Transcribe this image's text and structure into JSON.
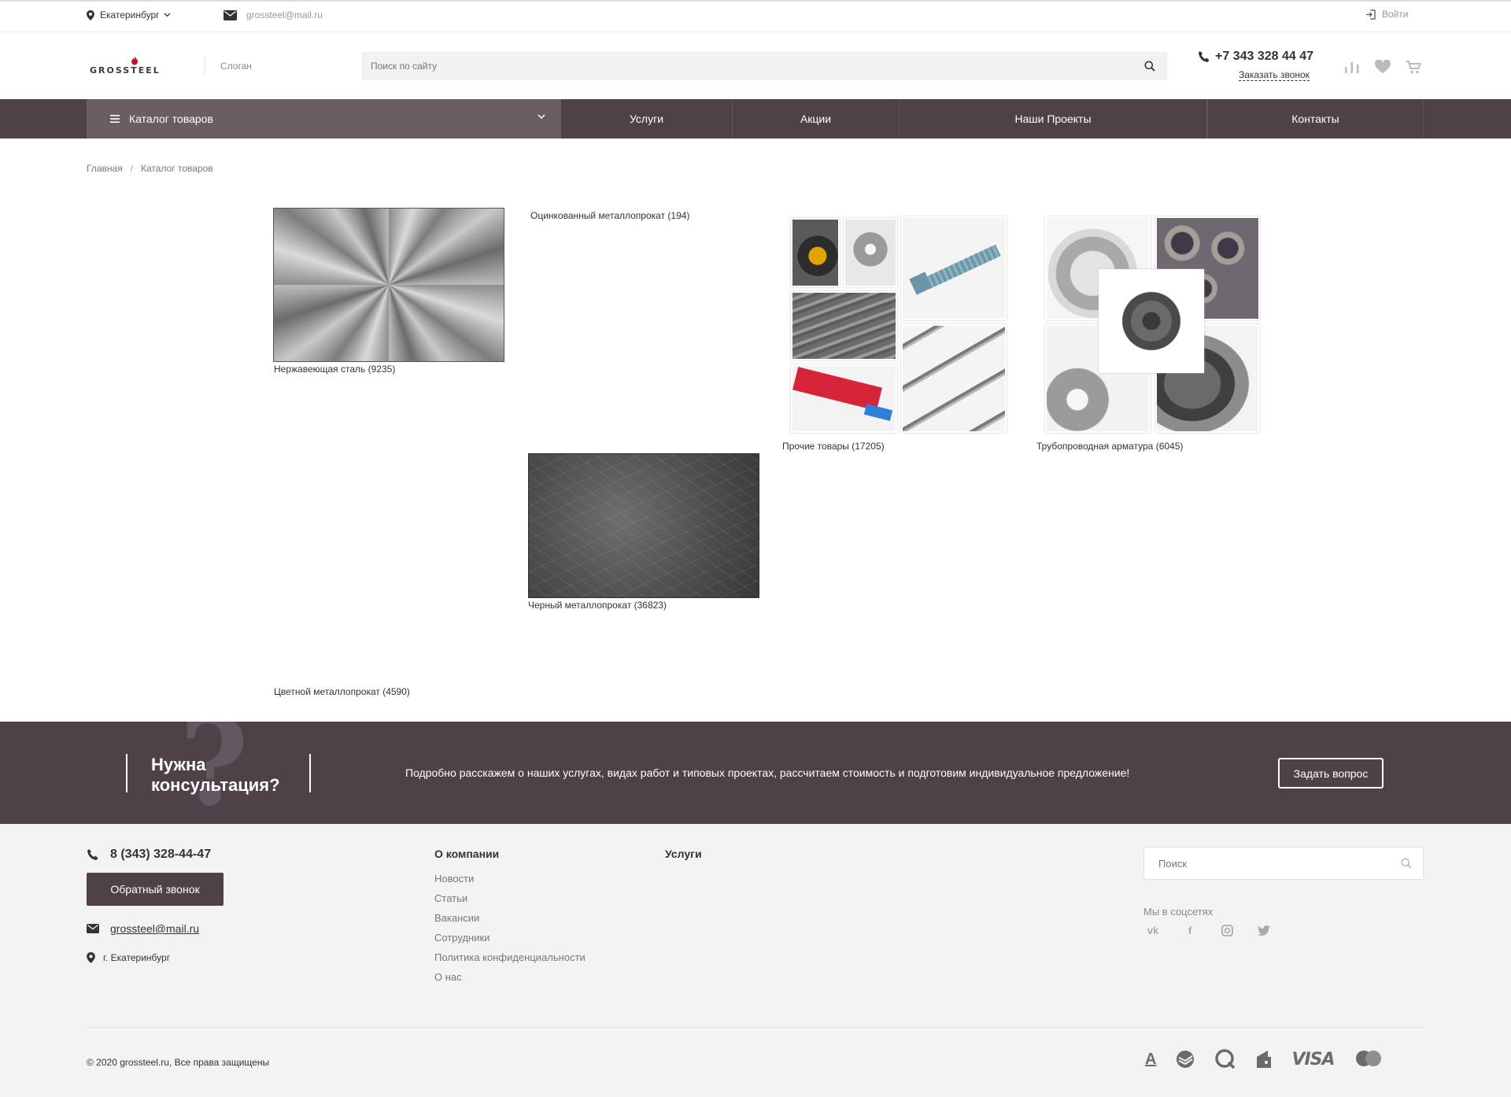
{
  "topbar": {
    "city": "Екатеринбург",
    "email": "grossteel@mail.ru",
    "login": "Войти"
  },
  "header": {
    "logo_text": "GROSSTEEL",
    "slogan": "Слоган",
    "search_placeholder": "Поиск по сайту",
    "phone": "+7 343 328 44 47",
    "callback": "Заказать звонок"
  },
  "nav": {
    "catalog": "Каталог товаров",
    "items": [
      "Услуги",
      "Акции",
      "Наши Проекты",
      "Контакты"
    ]
  },
  "breadcrumb": {
    "home": "Главная",
    "current": "Каталог товаров"
  },
  "catalog": {
    "stainless": "Нержавеющая сталь (9235)",
    "galvanized": "Оцинкованный металлопрокат (194)",
    "other": "Прочие товары (17205)",
    "pipe_fittings": "Трубопроводная арматура (6045)",
    "black_metal": "Черный металлопрокат (36823)",
    "nonferrous": "Цветной металлопрокат (4590)"
  },
  "consult": {
    "title_line1": "Нужна",
    "title_line2": "консультация?",
    "text": "Подробно расскажем о наших услугах, видах работ и типовых проектах, рассчитаем стоимость и подготовим индивидуальное предложение!",
    "button": "Задать вопрос"
  },
  "footer": {
    "phone": "8 (343) 328-44-47",
    "callback_button": "Обратный звонок",
    "email": "grossteel@mail.ru",
    "address": "г. Екатеринбург",
    "company_title": "О компании",
    "company_links": [
      "Новости",
      "Статьи",
      "Вакансии",
      "Сотрудники",
      "Политика конфиденциальности",
      "О нас"
    ],
    "services_title": "Услуги",
    "search_placeholder": "Поиск",
    "social_title": "Мы в соцсетях",
    "copyright": "© 2020 grossteel.ru, Все права защищены",
    "social_icons": [
      "vk-icon",
      "facebook-icon",
      "instagram-icon",
      "twitter-icon"
    ],
    "payment_icons": [
      "alfabank-icon",
      "sberbank-icon",
      "qiwi-icon",
      "yandex-money-icon",
      "visa-icon",
      "mastercard-icon"
    ],
    "visa_text": "VISA"
  },
  "colors": {
    "brand_dark": "#4e4148",
    "catalog_button": "#6a5d64",
    "footer_bg": "#f4f3f3",
    "logo_red": "#c8102e"
  }
}
